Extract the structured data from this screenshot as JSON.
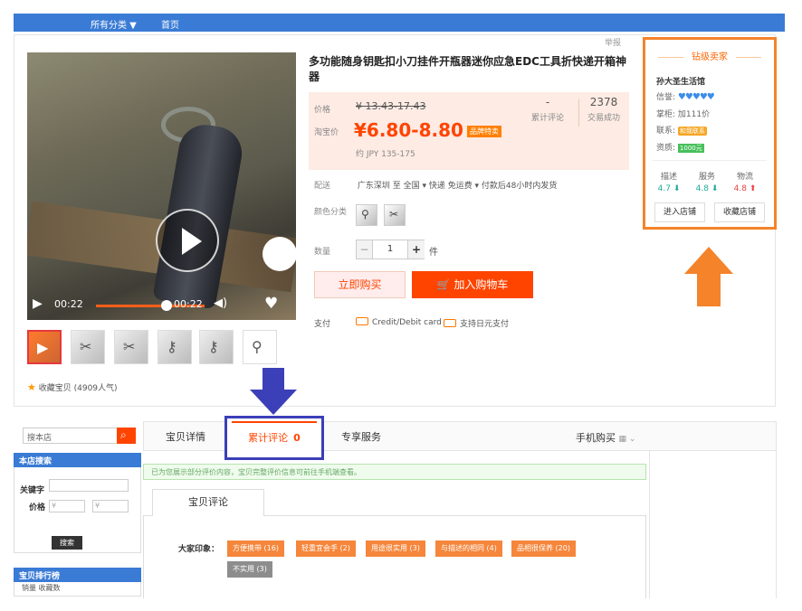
{
  "topnav": {
    "all_categories": "所有分类 ▼",
    "home": "首页"
  },
  "report": "举报",
  "video": {
    "time_current": "00:22",
    "time_total": "00:22"
  },
  "thumbs": [
    "play-thumbnail",
    "knife-thumbnail",
    "tools-thumbnail",
    "bottle-opener-thumbnail",
    "keychain-thumbnail",
    "keyring-thumbnail"
  ],
  "favorite": {
    "label": "收藏宝贝 (4909人气)"
  },
  "product": {
    "title": "多功能随身钥匙扣小刀挂件开瓶器迷你应急EDC工具折快递开箱神器",
    "price_label": "价格",
    "original_price": "¥ 13.43-17.43",
    "promo_label": "淘宝价",
    "current_price": "¥6.80-8.80",
    "badge": "品牌特卖",
    "jpy": "约 JPY 135-175",
    "reviews_count": "-",
    "reviews_label": "累计评论",
    "sales_count": "2378",
    "sales_label": "交易成功",
    "shipping_label": "配送",
    "shipping_value": "广东深圳 至  全国 ▾   快递 免运费 ▾   付款后48小时内发货",
    "color_label": "颜色分类",
    "quantity_label": "数量",
    "quantity": "1",
    "unit": "件",
    "buy_now": "立即购买",
    "add_cart": "加入购物车",
    "pay_label": "支付",
    "pay_card": "Credit/Debit card",
    "pay_jpy": "支持日元支付"
  },
  "seller": {
    "level": "钻级卖家",
    "shop_name": "孙大圣生活馆",
    "credit_label": "信誉:",
    "hearts": "♥♥♥♥♥",
    "deposit_label": "掌柜:",
    "deposit_value": "加111价",
    "contact_label": "联系:",
    "contact_badge": "和我联系",
    "qualification_label": "资质:",
    "qualification_badge": "1000元",
    "score_desc_label": "描述",
    "score_desc": "4.7 ⬇",
    "score_service_label": "服务",
    "score_service": "4.8 ⬇",
    "score_logistics_label": "物流",
    "score_logistics": "4.8 ⬆",
    "enter_shop": "进入店铺",
    "fav_shop": "收藏店铺"
  },
  "colors": {
    "accent_orange": "#ff4400",
    "highlight_orange": "#f4832a",
    "nav_blue": "#3a7bd5",
    "highlight_blue": "#3b3fb8"
  },
  "sidebar": {
    "search_placeholder": "搜本店",
    "store_search": "本店搜索",
    "keyword_label": "关键字",
    "price_label": "价格",
    "price_min": "¥",
    "price_max": "¥",
    "search_button": "搜索",
    "rank_title": "宝贝排行榜",
    "rank_tabs": "销量  收藏数"
  },
  "tabs": {
    "details": "宝贝详情",
    "reviews": "累计评论",
    "reviews_count": "0",
    "services": "专享服务",
    "mobile": "手机购买",
    "mobile_icon": "▦ ⌄"
  },
  "reviews": {
    "notice": "已为您展示部分评价内容，宝贝完整评价信息可前往手机端查看。",
    "tab": "宝贝评论",
    "impression_label": "大家印象：",
    "tags": [
      {
        "text": "方便携带 (16)",
        "type": "orange"
      },
      {
        "text": "轻重宜会手 (2)",
        "type": "orange"
      },
      {
        "text": "用途很实用 (3)",
        "type": "orange"
      },
      {
        "text": "与描述的相同 (4)",
        "type": "orange"
      },
      {
        "text": "品相很保养 (20)",
        "type": "orange"
      },
      {
        "text": "不实用 (3)",
        "type": "gray"
      }
    ]
  }
}
